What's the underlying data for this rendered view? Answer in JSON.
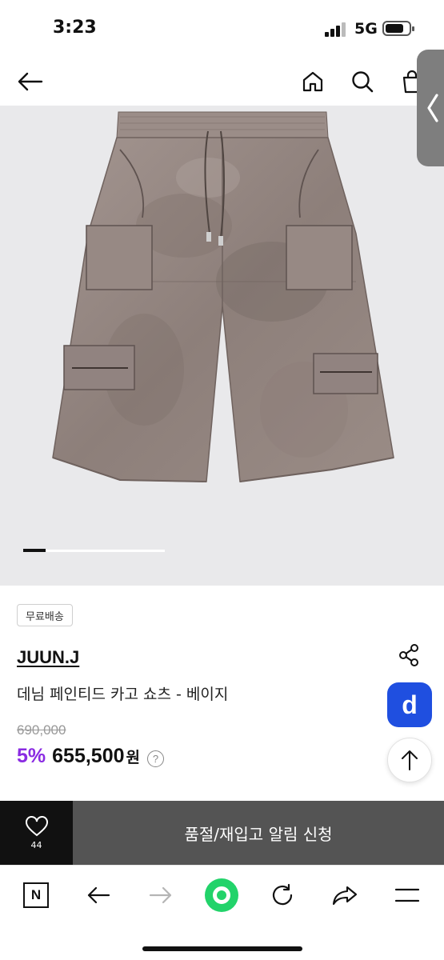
{
  "status_bar": {
    "time": "3:23",
    "network": "5G"
  },
  "product": {
    "badge": "무료배송",
    "brand": "JUUN.J",
    "name": "데님 페인티드 카고 쇼츠 - 베이지",
    "original_price": "690,000",
    "discount": "5%",
    "sale_price": "655,500",
    "currency": "원",
    "help": "?",
    "image_slide": 1,
    "image_slide_fraction": 0.16
  },
  "floating": {
    "d_label": "d"
  },
  "bottom_bar": {
    "like_count": "44",
    "cta_label": "품절/재입고 알림 신청"
  },
  "toolbar": {
    "n_label": "N"
  },
  "colors": {
    "discount": "#8a2be2",
    "d_button": "#1f4fe0",
    "cta": "#545454",
    "like_bg": "#111111",
    "toolbar_center": "#22d36a"
  },
  "icons": [
    "back-arrow-icon",
    "home-icon",
    "search-icon",
    "bag-icon",
    "chevron-left-icon",
    "share-icon",
    "arrow-up-icon",
    "heart-icon",
    "n-icon",
    "back-icon",
    "forward-icon",
    "green-dot-icon",
    "refresh-icon",
    "share-arrow-icon",
    "menu-icon"
  ]
}
